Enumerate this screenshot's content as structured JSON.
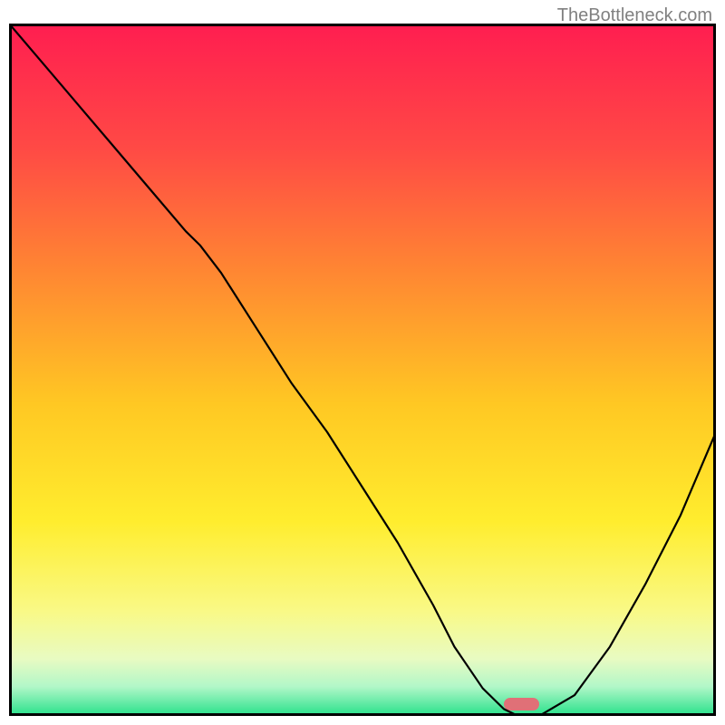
{
  "watermark": "TheBottleneck.com",
  "chart_data": {
    "type": "line",
    "xlabel": "",
    "ylabel": "",
    "xlim": [
      0,
      100
    ],
    "ylim": [
      0,
      100
    ],
    "title": "",
    "series": [
      {
        "name": "bottleneck-curve",
        "x": [
          0,
          5,
          10,
          15,
          20,
          25,
          27,
          30,
          35,
          40,
          45,
          50,
          55,
          60,
          63,
          67,
          70,
          72,
          75,
          80,
          85,
          90,
          95,
          100
        ],
        "values": [
          100,
          94,
          88,
          82,
          76,
          70,
          68,
          64,
          56,
          48,
          41,
          33,
          25,
          16,
          10,
          4,
          1,
          0,
          0,
          3,
          10,
          19,
          29,
          41
        ]
      }
    ],
    "marker": {
      "x_start": 70,
      "x_end": 75,
      "color": "#e07077"
    },
    "gradient_stops": [
      {
        "offset": 0.0,
        "color": "#ff1e50"
      },
      {
        "offset": 0.18,
        "color": "#ff4a45"
      },
      {
        "offset": 0.35,
        "color": "#ff8433"
      },
      {
        "offset": 0.55,
        "color": "#ffc823"
      },
      {
        "offset": 0.72,
        "color": "#ffed2e"
      },
      {
        "offset": 0.85,
        "color": "#f9f986"
      },
      {
        "offset": 0.92,
        "color": "#e8fbc2"
      },
      {
        "offset": 0.96,
        "color": "#b2f7c8"
      },
      {
        "offset": 1.0,
        "color": "#2fe28e"
      }
    ],
    "border_color": "#000000",
    "curve_color": "#000000",
    "curve_width": 2.2
  }
}
